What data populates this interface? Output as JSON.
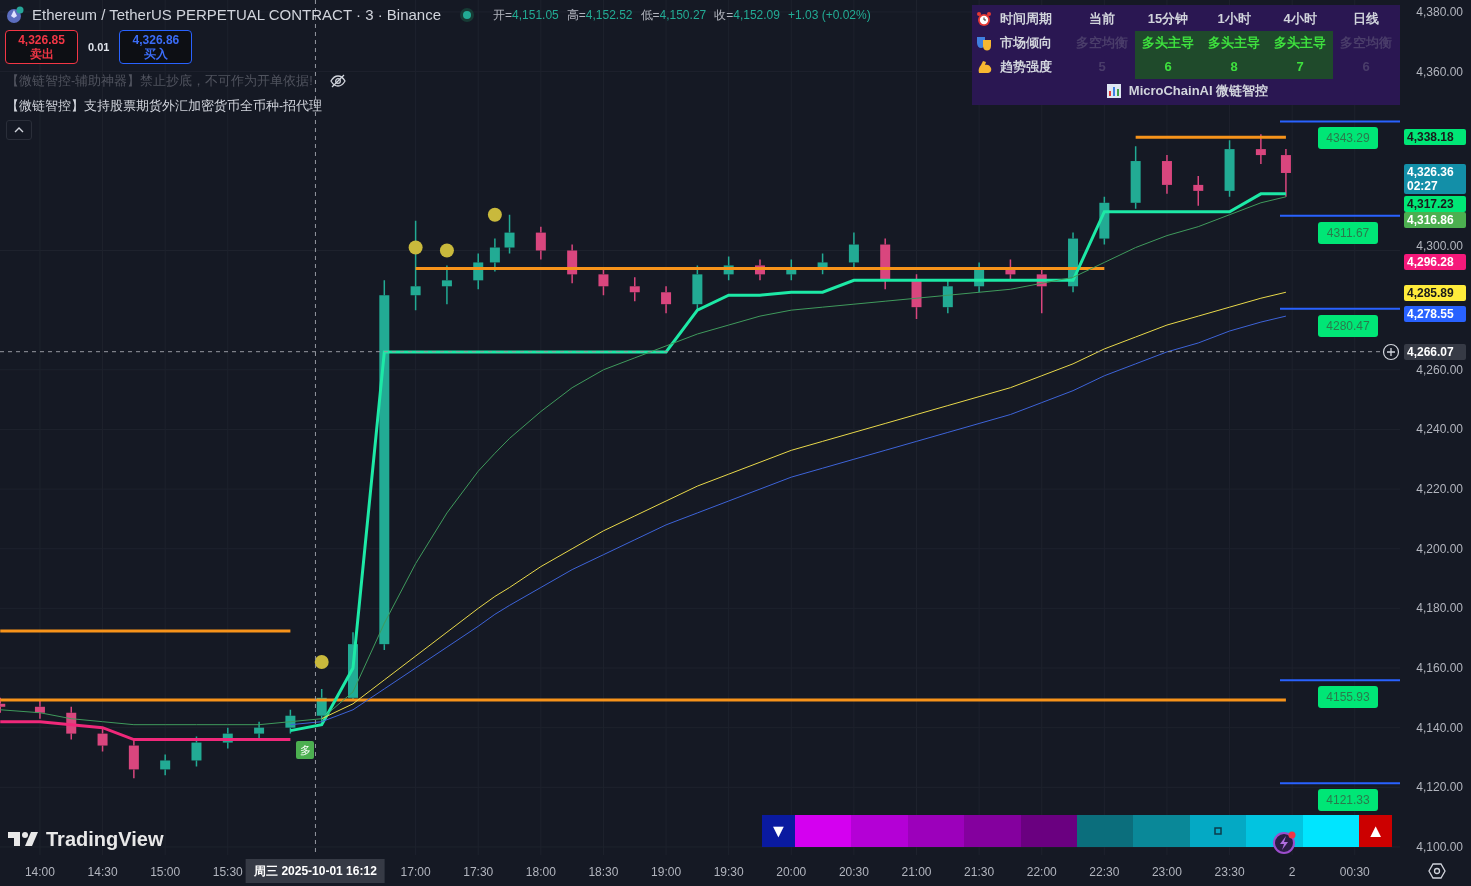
{
  "header": {
    "title": "Ethereum / TetherUS PERPETUAL CONTRACT · 3 · Binance",
    "ohlc": [
      {
        "label": "开=",
        "value": "4,151.05"
      },
      {
        "label": "高=",
        "value": "4,152.52"
      },
      {
        "label": "低=",
        "value": "4,150.27"
      },
      {
        "label": "收=",
        "value": "4,152.09"
      }
    ],
    "change": "+1.03 (+0.02%)"
  },
  "trade": {
    "sell": {
      "price": "4,326.85",
      "label": "卖出"
    },
    "spread": "0.01",
    "buy": {
      "price": "4,326.86",
      "label": "买入"
    }
  },
  "indicators": [
    {
      "text": "【微链智控-辅助神器】禁止抄底，不可作为开单依据!",
      "hidden": true
    },
    {
      "text": "【微链智控】支持股票期货外汇加密货币全币种-招代理",
      "hidden": false
    }
  ],
  "trend_table": {
    "header": {
      "label": "时间周期",
      "columns": [
        "当前",
        "15分钟",
        "1小时",
        "4小时",
        "日线"
      ]
    },
    "rows": [
      {
        "label": "市场倾向",
        "cells": [
          {
            "text": "多空均衡",
            "highlighted": false
          },
          {
            "text": "多头主导",
            "highlighted": true
          },
          {
            "text": "多头主导",
            "highlighted": true
          },
          {
            "text": "多头主导",
            "highlighted": true
          },
          {
            "text": "多空均衡",
            "highlighted": false
          }
        ]
      },
      {
        "label": "趋势强度",
        "cells": [
          {
            "text": "5",
            "highlighted": false
          },
          {
            "text": "6",
            "highlighted": true
          },
          {
            "text": "8",
            "highlighted": true
          },
          {
            "text": "7",
            "highlighted": true
          },
          {
            "text": "6",
            "highlighted": false
          }
        ]
      }
    ],
    "footer": "MicroChainAI 微链智控"
  },
  "chart": {
    "chart_data": {
      "type": "candlestick",
      "grid": true,
      "ref_lines": [
        {
          "axis": "y",
          "value": 4343.29,
          "label": "4343.29",
          "color": "#2962ff"
        },
        {
          "axis": "y",
          "value": 4311.67,
          "label": "4311.67",
          "color": "#2962ff"
        },
        {
          "axis": "y",
          "value": 4280.47,
          "label": "4280.47",
          "color": "#2962ff"
        },
        {
          "axis": "y",
          "value": 4155.93,
          "label": "4155.93",
          "color": "#2962ff"
        },
        {
          "axis": "y",
          "value": 4121.33,
          "label": "4121.33",
          "color": "#2962ff"
        },
        {
          "axis": "x",
          "value": 16.2,
          "color": "#9598a1"
        },
        {
          "axis": "y",
          "value": 4266.07,
          "label": "4,266.07",
          "color": "#9598a1"
        }
      ],
      "xlim": [
        13.681,
        24.861
      ],
      "ylim": [
        4097.3,
        4384
      ],
      "x": [
        13.683,
        14,
        14.25,
        14.5,
        14.75,
        15,
        15.25,
        15.5,
        15.75,
        16,
        16.25,
        16.5,
        16.75,
        17,
        17.25,
        17.5,
        17.633,
        17.75,
        18,
        18.25,
        18.5,
        18.75,
        19,
        19.25,
        19.5,
        19.75,
        20,
        20.25,
        20.5,
        20.75,
        21,
        21.25,
        21.5,
        21.75,
        22,
        22.25,
        22.5,
        22.75,
        23,
        23.25,
        23.5,
        23.75,
        23.95
      ],
      "ohlc": [
        [
          4148,
          4150,
          4145,
          4147
        ],
        [
          4147,
          4149,
          4143,
          4145
        ],
        [
          4145,
          4147,
          4136,
          4138
        ],
        [
          4138,
          4140,
          4132,
          4134
        ],
        [
          4134,
          4136,
          4123,
          4126
        ],
        [
          4126,
          4131,
          4124,
          4129
        ],
        [
          4129,
          4137,
          4127,
          4135
        ],
        [
          4135,
          4140,
          4133,
          4138
        ],
        [
          4138,
          4142,
          4136,
          4140
        ],
        [
          4140,
          4146,
          4138,
          4144
        ],
        [
          4144,
          4153,
          4142,
          4150
        ],
        [
          4150,
          4172,
          4149,
          4168
        ],
        [
          4168,
          4290,
          4166,
          4285
        ],
        [
          4285,
          4310,
          4280,
          4288
        ],
        [
          4288,
          4295,
          4282,
          4290
        ],
        [
          4290,
          4299,
          4287,
          4296
        ],
        [
          4296,
          4304,
          4293,
          4301
        ],
        [
          4301,
          4312,
          4299,
          4306
        ],
        [
          4306,
          4308,
          4297,
          4300
        ],
        [
          4300,
          4302,
          4289,
          4292
        ],
        [
          4292,
          4294,
          4285,
          4288
        ],
        [
          4288,
          4291,
          4283,
          4286
        ],
        [
          4286,
          4288,
          4279,
          4282
        ],
        [
          4282,
          4295,
          4280,
          4292
        ],
        [
          4292,
          4298,
          4290,
          4295
        ],
        [
          4295,
          4297,
          4290,
          4292
        ],
        [
          4292,
          4297,
          4290,
          4294
        ],
        [
          4294,
          4299,
          4292,
          4296
        ],
        [
          4296,
          4306,
          4294,
          4302
        ],
        [
          4302,
          4304,
          4287,
          4290
        ],
        [
          4290,
          4292,
          4277,
          4281
        ],
        [
          4281,
          4290,
          4279,
          4288
        ],
        [
          4288,
          4296,
          4286,
          4294
        ],
        [
          4294,
          4297,
          4290,
          4292
        ],
        [
          4292,
          4294,
          4279,
          4288
        ],
        [
          4288,
          4306,
          4286,
          4304
        ],
        [
          4304,
          4318,
          4302,
          4316
        ],
        [
          4316,
          4335,
          4314,
          4330
        ],
        [
          4330,
          4332,
          4319,
          4322
        ],
        [
          4322,
          4325,
          4315,
          4320
        ],
        [
          4320,
          4337,
          4318,
          4334
        ],
        [
          4334,
          4339,
          4329,
          4332
        ],
        [
          4332,
          4334,
          4318,
          4326
        ]
      ],
      "series": [
        {
          "type": "line",
          "color": "#f0287a",
          "values": [
            4142,
            4142,
            4141,
            4140,
            4136,
            4136,
            4136,
            4136,
            4136,
            4136,
            null,
            null,
            null,
            null,
            null,
            null,
            null,
            null,
            null,
            null,
            null,
            null,
            null,
            null,
            null,
            null,
            null,
            null,
            null,
            null,
            null,
            null,
            null,
            null,
            null,
            null,
            null,
            null,
            null,
            null,
            null,
            null,
            null
          ]
        },
        {
          "type": "line",
          "color": "#1de9a6",
          "values": [
            null,
            null,
            null,
            null,
            null,
            null,
            null,
            null,
            null,
            4139,
            4141,
            4160,
            4266,
            4266,
            4266,
            4266,
            4266,
            4266,
            4266,
            4266,
            4266,
            4266,
            4266,
            4280,
            4285,
            4285,
            4286,
            4286,
            4290,
            4290,
            4290,
            4290,
            4290,
            4290,
            4290,
            4290,
            4313,
            4313,
            4313,
            4313,
            4313,
            4319,
            4319
          ]
        },
        {
          "type": "line",
          "color": "#3f9a5c",
          "values": [
            4146,
            4145,
            4143,
            4142,
            4141,
            4141,
            4141,
            4141,
            4141,
            4142,
            4143,
            4152,
            4175,
            4195,
            4212,
            4226,
            4232,
            4237,
            4246,
            4254,
            4260,
            4264,
            4268,
            4272,
            4275,
            4278,
            4280,
            4281,
            4282,
            4283,
            4284,
            4285,
            4286,
            4287,
            4289,
            4291,
            4296,
            4301,
            4305,
            4308,
            4312,
            4316,
            4318
          ]
        },
        {
          "type": "line",
          "color": "#e8d84a",
          "values": [
            null,
            null,
            null,
            null,
            null,
            null,
            null,
            null,
            null,
            null,
            4143,
            4148,
            4156,
            4164,
            4172,
            4180,
            4184,
            4187,
            4194,
            4200,
            4206,
            4211,
            4216,
            4221,
            4225,
            4229,
            4233,
            4236,
            4239,
            4242,
            4245,
            4248,
            4251,
            4254,
            4258,
            4262,
            4267,
            4271,
            4275,
            4278,
            4281,
            4284,
            4286
          ]
        },
        {
          "type": "line",
          "color": "#3d63d8",
          "values": [
            null,
            null,
            null,
            null,
            null,
            null,
            null,
            null,
            null,
            4141,
            4142,
            4146,
            4153,
            4160,
            4167,
            4174,
            4178,
            4181,
            4187,
            4193,
            4198,
            4203,
            4208,
            4212,
            4216,
            4220,
            4224,
            4227,
            4230,
            4233,
            4236,
            4239,
            4242,
            4245,
            4249,
            4253,
            4258,
            4262,
            4266,
            4269,
            4273,
            4276,
            4278
          ]
        },
        {
          "type": "line",
          "color": "#f7931a",
          "values": [
            4172.4,
            4172.4,
            4172.4,
            4172.4,
            4172.4,
            4172.4,
            4172.4,
            4172.4,
            4172.4,
            4172.4,
            null,
            null,
            null,
            null,
            null,
            null,
            null,
            null,
            null,
            null,
            null,
            null,
            null,
            null,
            null,
            null,
            null,
            null,
            null,
            null,
            null,
            null,
            null,
            null,
            null,
            null,
            null,
            null,
            null,
            null,
            null,
            null,
            null
          ]
        },
        {
          "type": "line",
          "color": "#f7931a",
          "values": [
            4149.3,
            4149.3,
            4149.3,
            4149.3,
            4149.3,
            4149.3,
            4149.3,
            4149.3,
            4149.3,
            4149.3,
            4149.3,
            4149.3,
            4149.3,
            4149.3,
            4149.3,
            4149.3,
            4149.3,
            4149.3,
            4149.3,
            4149.3,
            4149.3,
            4149.3,
            4149.3,
            4149.3,
            4149.3,
            4149.3,
            4149.3,
            4149.3,
            4149.3,
            4149.3,
            4149.3,
            4149.3,
            4149.3,
            4149.3,
            4149.3,
            4149.3,
            4149.3,
            4149.3,
            4149.3,
            4149.3,
            4149.3,
            4149.3,
            4149.3
          ]
        },
        {
          "type": "line",
          "color": "#f7931a",
          "values": [
            null,
            null,
            null,
            null,
            null,
            null,
            null,
            null,
            null,
            null,
            null,
            null,
            null,
            4294,
            4294,
            4294,
            4294,
            4294,
            4294,
            4294,
            4294,
            4294,
            4294,
            4294,
            4294,
            4294,
            4294,
            4294,
            4294,
            4294,
            4294,
            4294,
            4294,
            4294,
            4294,
            4294,
            4294,
            null,
            null,
            null,
            null,
            null,
            null
          ]
        },
        {
          "type": "line",
          "color": "#f7931a",
          "values": [
            null,
            null,
            null,
            null,
            null,
            null,
            null,
            null,
            null,
            null,
            null,
            null,
            null,
            null,
            null,
            null,
            null,
            null,
            null,
            null,
            null,
            null,
            null,
            null,
            null,
            null,
            null,
            null,
            null,
            null,
            null,
            null,
            null,
            null,
            null,
            null,
            null,
            4338,
            4338,
            4338,
            4338,
            4338,
            4338
          ]
        },
        {
          "type": "scatter",
          "color": "#c9b93c",
          "values": [
            null,
            null,
            null,
            null,
            null,
            null,
            null,
            null,
            null,
            null,
            4162,
            null,
            null,
            4301,
            4300,
            null,
            4312,
            null,
            null,
            null,
            null,
            null,
            null,
            null,
            null,
            null,
            null,
            null,
            null,
            null,
            null,
            null,
            null,
            null,
            null,
            null,
            null,
            null,
            null,
            null,
            null,
            null,
            null
          ]
        }
      ],
      "yticks": [
        {
          "value": 4380,
          "label": "4,380.00"
        },
        {
          "value": 4360,
          "label": "4,360.00"
        },
        {
          "value": 4300,
          "label": "4,300.00"
        },
        {
          "value": 4260,
          "label": "4,260.00"
        },
        {
          "value": 4240,
          "label": "4,240.00"
        },
        {
          "value": 4220,
          "label": "4,220.00"
        },
        {
          "value": 4200,
          "label": "4,200.00"
        },
        {
          "value": 4180,
          "label": "4,180.00"
        },
        {
          "value": 4160,
          "label": "4,160.00"
        },
        {
          "value": 4140,
          "label": "4,140.00"
        },
        {
          "value": 4120,
          "label": "4,120.00"
        },
        {
          "value": 4100,
          "label": "4,100.00"
        }
      ],
      "xticks": [
        {
          "value": 14,
          "label": "14:00"
        },
        {
          "value": 14.5,
          "label": "14:30"
        },
        {
          "value": 15,
          "label": "15:00"
        },
        {
          "value": 15.5,
          "label": "15:30"
        },
        {
          "value": 17,
          "label": "17:00"
        },
        {
          "value": 17.5,
          "label": "17:30"
        },
        {
          "value": 18,
          "label": "18:00"
        },
        {
          "value": 18.5,
          "label": "18:30"
        },
        {
          "value": 19,
          "label": "19:00"
        },
        {
          "value": 19.5,
          "label": "19:30"
        },
        {
          "value": 20,
          "label": "20:00"
        },
        {
          "value": 20.5,
          "label": "20:30"
        },
        {
          "value": 21,
          "label": "21:00"
        },
        {
          "value": 21.5,
          "label": "21:30"
        },
        {
          "value": 22,
          "label": "22:00"
        },
        {
          "value": 22.5,
          "label": "22:30"
        },
        {
          "value": 23,
          "label": "23:00"
        },
        {
          "value": 23.5,
          "label": "23:30"
        }
      ]
    },
    "next_day_ticks": [
      {
        "label": "2"
      },
      {
        "label": "00:30"
      }
    ]
  },
  "signal_marker": {
    "text": "多"
  },
  "price_tags": [
    {
      "label": "4,338.18",
      "color": "#00e676"
    },
    {
      "label": "4,326.36",
      "sublabel": "02:27",
      "color": "#138fa8"
    },
    {
      "label": "4,317.23",
      "color": "#00e676"
    },
    {
      "label": "4,316.86",
      "color": "#4caf50"
    },
    {
      "label": "4,296.28",
      "color": "#f5197a"
    },
    {
      "label": "4,285.89",
      "color": "#ffeb3b"
    },
    {
      "label": "4,278.55",
      "color": "#2962ff"
    }
  ],
  "crosshair": {
    "time_label": "周三 2025-10-01 16:12"
  },
  "signal_bar": {
    "cells": [
      {
        "kind": "arrow",
        "symbol": "▼",
        "color": "#0a1aa0"
      },
      {
        "kind": "color",
        "color": "#d400f0"
      },
      {
        "kind": "color",
        "color": "#b400d6"
      },
      {
        "kind": "color",
        "color": "#9c00bb"
      },
      {
        "kind": "color",
        "color": "#84009e"
      },
      {
        "kind": "color",
        "color": "#6a0080"
      },
      {
        "kind": "color",
        "color": "#0b6e7c"
      },
      {
        "kind": "color",
        "color": "#0a8898"
      },
      {
        "kind": "marker",
        "color": "#04a9c4"
      },
      {
        "kind": "color",
        "color": "#02c4e0"
      },
      {
        "kind": "color",
        "color": "#00e5ff"
      },
      {
        "kind": "arrow",
        "symbol": "▲",
        "color": "#cc0000"
      }
    ]
  },
  "brand": "TradingView"
}
